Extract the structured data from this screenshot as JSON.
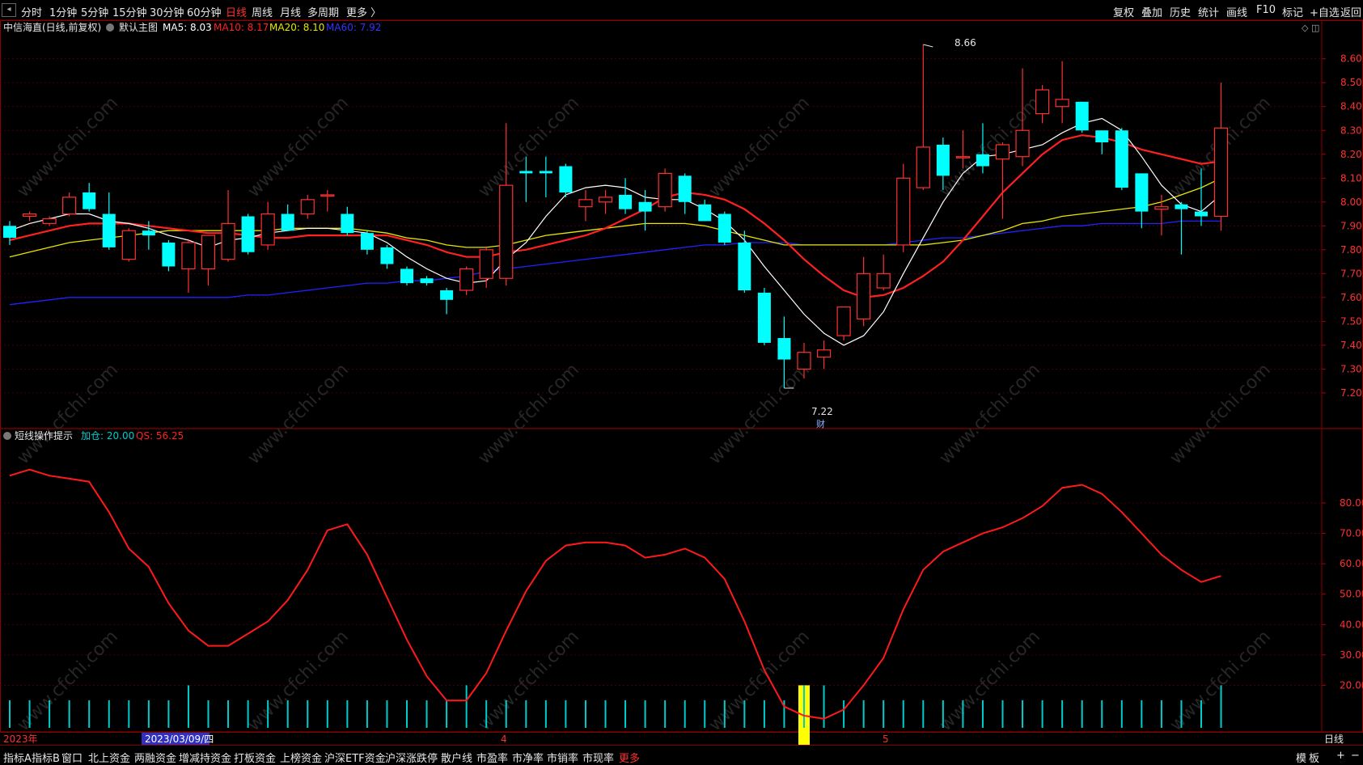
{
  "top_tabs": [
    "分时",
    "1分钟",
    "5分钟",
    "15分钟",
    "30分钟",
    "60分钟",
    "日线",
    "周线",
    "月线",
    "多周期",
    "更多 〉"
  ],
  "active_tab": "日线",
  "right_tools": [
    "复权",
    "叠加",
    "历史",
    "统计",
    "画线",
    "F10",
    "标记",
    "+自选",
    "返回"
  ],
  "main_legend": {
    "stock": "中信海直(日线,前复权)",
    "template": "默认主图",
    "ma5": "MA5: 8.03",
    "ma10": "MA10: 8.17",
    "ma20": "MA20: 8.10",
    "ma60": "MA60: 7.92"
  },
  "sub_legend": {
    "name": "短线操作提示",
    "jiacang": "加仓: 20.00",
    "qs": "QS: 56.25"
  },
  "annotations": {
    "high": "8.66",
    "low": "7.22",
    "cai": "财"
  },
  "watermark": "www.cfchi.com",
  "date_axis": {
    "year": "2023年",
    "cursor_date": "2023/03/09/四",
    "m4": "4",
    "m5": "5",
    "period": "日线"
  },
  "bottom_tabs": [
    "指标A",
    "指标B",
    "窗口",
    "北上资金",
    "两融资金",
    "增减持资金",
    "打板资金",
    "上榜资金",
    "沪深ETF资金",
    "沪深涨跌停",
    "散户线",
    "市盈率",
    "市净率",
    "市销率",
    "市现率",
    "更多"
  ],
  "bottom_right": [
    "模",
    "板",
    "+",
    "−"
  ],
  "colors": {
    "up": "#ff3030",
    "down": "#00ffff",
    "ma5": "#ffffff",
    "ma10": "#ff2020",
    "ma20": "#e6e600",
    "ma60": "#2222ff",
    "qs": "#ff1a1a",
    "signal": "#ffff00",
    "frame": "#8b0000"
  },
  "chart_data": {
    "type": "candlestick",
    "price_axis": {
      "ylim": [
        7.15,
        8.7
      ],
      "ticks": [
        "8.60",
        "8.50",
        "8.40",
        "8.30",
        "8.20",
        "8.10",
        "8.00",
        "7.90",
        "7.80",
        "7.70",
        "7.60",
        "7.50",
        "7.40",
        "7.30",
        "7.20"
      ]
    },
    "candles": [
      {
        "o": 7.9,
        "h": 7.92,
        "l": 7.82,
        "c": 7.85
      },
      {
        "o": 7.94,
        "h": 7.96,
        "l": 7.92,
        "c": 7.95
      },
      {
        "o": 7.91,
        "h": 7.94,
        "l": 7.9,
        "c": 7.93
      },
      {
        "o": 7.95,
        "h": 8.04,
        "l": 7.94,
        "c": 8.02
      },
      {
        "o": 8.04,
        "h": 8.08,
        "l": 7.96,
        "c": 7.97
      },
      {
        "o": 7.95,
        "h": 8.04,
        "l": 7.8,
        "c": 7.81
      },
      {
        "o": 7.76,
        "h": 7.89,
        "l": 7.75,
        "c": 7.88
      },
      {
        "o": 7.88,
        "h": 7.92,
        "l": 7.8,
        "c": 7.86
      },
      {
        "o": 7.83,
        "h": 7.84,
        "l": 7.71,
        "c": 7.73
      },
      {
        "o": 7.72,
        "h": 7.84,
        "l": 7.62,
        "c": 7.83
      },
      {
        "o": 7.72,
        "h": 7.86,
        "l": 7.65,
        "c": 7.86
      },
      {
        "o": 7.76,
        "h": 8.05,
        "l": 7.75,
        "c": 7.91
      },
      {
        "o": 7.94,
        "h": 7.95,
        "l": 7.78,
        "c": 7.79
      },
      {
        "o": 7.82,
        "h": 8.0,
        "l": 7.8,
        "c": 7.95
      },
      {
        "o": 7.95,
        "h": 7.99,
        "l": 7.88,
        "c": 7.88
      },
      {
        "o": 7.95,
        "h": 8.03,
        "l": 7.93,
        "c": 8.01
      },
      {
        "o": 8.03,
        "h": 8.05,
        "l": 7.96,
        "c": 8.03
      },
      {
        "o": 7.95,
        "h": 7.98,
        "l": 7.86,
        "c": 7.87
      },
      {
        "o": 7.87,
        "h": 7.88,
        "l": 7.78,
        "c": 7.8
      },
      {
        "o": 7.81,
        "h": 7.82,
        "l": 7.72,
        "c": 7.74
      },
      {
        "o": 7.72,
        "h": 7.73,
        "l": 7.65,
        "c": 7.66
      },
      {
        "o": 7.68,
        "h": 7.69,
        "l": 7.65,
        "c": 7.66
      },
      {
        "o": 7.63,
        "h": 7.64,
        "l": 7.53,
        "c": 7.59
      },
      {
        "o": 7.63,
        "h": 7.73,
        "l": 7.61,
        "c": 7.72
      },
      {
        "o": 7.68,
        "h": 7.81,
        "l": 7.64,
        "c": 7.8
      },
      {
        "o": 7.68,
        "h": 8.33,
        "l": 7.65,
        "c": 8.07
      },
      {
        "o": 8.13,
        "h": 8.19,
        "l": 8.0,
        "c": 8.12
      },
      {
        "o": 8.13,
        "h": 8.19,
        "l": 8.02,
        "c": 8.12
      },
      {
        "o": 8.15,
        "h": 8.16,
        "l": 8.02,
        "c": 8.04
      },
      {
        "o": 7.98,
        "h": 8.05,
        "l": 7.92,
        "c": 8.01
      },
      {
        "o": 8.0,
        "h": 8.05,
        "l": 7.95,
        "c": 8.02
      },
      {
        "o": 8.03,
        "h": 8.1,
        "l": 7.95,
        "c": 7.97
      },
      {
        "o": 8.0,
        "h": 8.05,
        "l": 7.88,
        "c": 7.96
      },
      {
        "o": 7.98,
        "h": 8.14,
        "l": 7.96,
        "c": 8.12
      },
      {
        "o": 8.11,
        "h": 8.12,
        "l": 7.95,
        "c": 8.0
      },
      {
        "o": 7.99,
        "h": 8.01,
        "l": 7.92,
        "c": 7.92
      },
      {
        "o": 7.95,
        "h": 7.96,
        "l": 7.82,
        "c": 7.83
      },
      {
        "o": 7.83,
        "h": 7.88,
        "l": 7.62,
        "c": 7.63
      },
      {
        "o": 7.62,
        "h": 7.64,
        "l": 7.4,
        "c": 7.41
      },
      {
        "o": 7.43,
        "h": 7.52,
        "l": 7.22,
        "c": 7.34
      },
      {
        "o": 7.3,
        "h": 7.41,
        "l": 7.26,
        "c": 7.37
      },
      {
        "o": 7.35,
        "h": 7.42,
        "l": 7.3,
        "c": 7.38
      },
      {
        "o": 7.44,
        "h": 7.56,
        "l": 7.42,
        "c": 7.56
      },
      {
        "o": 7.51,
        "h": 7.77,
        "l": 7.48,
        "c": 7.7
      },
      {
        "o": 7.64,
        "h": 7.78,
        "l": 7.63,
        "c": 7.7
      },
      {
        "o": 7.82,
        "h": 8.16,
        "l": 7.79,
        "c": 8.1
      },
      {
        "o": 8.06,
        "h": 8.66,
        "l": 8.05,
        "c": 8.23
      },
      {
        "o": 8.24,
        "h": 8.27,
        "l": 8.05,
        "c": 8.11
      },
      {
        "o": 8.19,
        "h": 8.3,
        "l": 8.14,
        "c": 8.19
      },
      {
        "o": 8.2,
        "h": 8.33,
        "l": 8.12,
        "c": 8.15
      },
      {
        "o": 8.18,
        "h": 8.25,
        "l": 7.93,
        "c": 8.24
      },
      {
        "o": 8.19,
        "h": 8.56,
        "l": 8.15,
        "c": 8.3
      },
      {
        "o": 8.37,
        "h": 8.49,
        "l": 8.33,
        "c": 8.47
      },
      {
        "o": 8.4,
        "h": 8.59,
        "l": 8.33,
        "c": 8.43
      },
      {
        "o": 8.42,
        "h": 8.42,
        "l": 8.29,
        "c": 8.3
      },
      {
        "o": 8.3,
        "h": 8.3,
        "l": 8.2,
        "c": 8.25
      },
      {
        "o": 8.3,
        "h": 8.31,
        "l": 8.05,
        "c": 8.06
      },
      {
        "o": 8.12,
        "h": 8.12,
        "l": 7.89,
        "c": 7.96
      },
      {
        "o": 7.97,
        "h": 8.03,
        "l": 7.86,
        "c": 7.98
      },
      {
        "o": 7.99,
        "h": 8.0,
        "l": 7.78,
        "c": 7.97
      },
      {
        "o": 7.96,
        "h": 8.14,
        "l": 7.9,
        "c": 7.94
      },
      {
        "o": 7.94,
        "h": 8.5,
        "l": 7.88,
        "c": 8.31
      }
    ],
    "ma5": [
      7.88,
      7.91,
      7.93,
      7.95,
      7.95,
      7.92,
      7.91,
      7.89,
      7.86,
      7.84,
      7.81,
      7.84,
      7.85,
      7.87,
      7.88,
      7.89,
      7.89,
      7.88,
      7.87,
      7.83,
      7.77,
      7.72,
      7.68,
      7.66,
      7.67,
      7.76,
      7.83,
      7.94,
      8.03,
      8.06,
      8.07,
      8.06,
      8.02,
      8.01,
      8.01,
      7.97,
      7.92,
      7.84,
      7.73,
      7.63,
      7.53,
      7.45,
      7.4,
      7.44,
      7.54,
      7.7,
      7.85,
      8.0,
      8.12,
      8.19,
      8.2,
      8.22,
      8.24,
      8.29,
      8.33,
      8.35,
      8.3,
      8.19,
      8.07,
      7.99,
      7.96,
      8.03
    ],
    "ma10": [
      7.84,
      7.86,
      7.88,
      7.9,
      7.91,
      7.91,
      7.91,
      7.9,
      7.89,
      7.88,
      7.87,
      7.87,
      7.86,
      7.85,
      7.85,
      7.86,
      7.86,
      7.86,
      7.86,
      7.86,
      7.84,
      7.82,
      7.79,
      7.77,
      7.77,
      7.79,
      7.8,
      7.82,
      7.84,
      7.86,
      7.89,
      7.93,
      7.97,
      8.02,
      8.04,
      8.03,
      8.01,
      7.97,
      7.91,
      7.84,
      7.76,
      7.69,
      7.63,
      7.6,
      7.61,
      7.64,
      7.69,
      7.75,
      7.84,
      7.94,
      8.04,
      8.12,
      8.2,
      8.26,
      8.28,
      8.27,
      8.25,
      8.22,
      8.2,
      8.18,
      8.16,
      8.17
    ],
    "ma20": [
      7.77,
      7.79,
      7.81,
      7.83,
      7.84,
      7.85,
      7.86,
      7.87,
      7.88,
      7.88,
      7.88,
      7.88,
      7.88,
      7.88,
      7.89,
      7.89,
      7.89,
      7.89,
      7.88,
      7.87,
      7.85,
      7.84,
      7.82,
      7.81,
      7.81,
      7.82,
      7.84,
      7.86,
      7.87,
      7.88,
      7.89,
      7.9,
      7.91,
      7.91,
      7.91,
      7.9,
      7.88,
      7.86,
      7.84,
      7.82,
      7.82,
      7.82,
      7.82,
      7.82,
      7.82,
      7.82,
      7.82,
      7.83,
      7.84,
      7.86,
      7.88,
      7.91,
      7.92,
      7.94,
      7.95,
      7.96,
      7.97,
      7.98,
      8.0,
      8.03,
      8.06,
      8.1
    ],
    "ma60": [
      7.57,
      7.58,
      7.59,
      7.6,
      7.6,
      7.6,
      7.6,
      7.6,
      7.6,
      7.6,
      7.6,
      7.6,
      7.61,
      7.61,
      7.62,
      7.63,
      7.64,
      7.65,
      7.66,
      7.66,
      7.67,
      7.67,
      7.68,
      7.69,
      7.71,
      7.72,
      7.73,
      7.74,
      7.75,
      7.76,
      7.77,
      7.78,
      7.79,
      7.8,
      7.81,
      7.82,
      7.82,
      7.83,
      7.83,
      7.83,
      7.82,
      7.82,
      7.82,
      7.82,
      7.82,
      7.83,
      7.84,
      7.85,
      7.85,
      7.86,
      7.87,
      7.88,
      7.89,
      7.9,
      7.9,
      7.91,
      7.91,
      7.91,
      7.91,
      7.92,
      7.92,
      7.92
    ],
    "indicator": {
      "name": "短线操作提示",
      "ylim": [
        0,
        100
      ],
      "ticks": [
        "80.00",
        "70.00",
        "60.00",
        "50.00",
        "40.00",
        "30.00",
        "20.00"
      ],
      "qs": [
        89,
        91,
        89,
        88,
        87,
        77,
        65,
        59,
        47,
        38,
        33,
        33,
        37,
        41,
        48,
        58,
        71,
        73,
        63,
        49,
        35,
        23,
        15,
        15,
        24,
        38,
        51,
        61,
        66,
        67,
        67,
        66,
        62,
        63,
        65,
        62,
        55,
        41,
        25,
        13,
        10,
        9,
        12,
        20,
        29,
        45,
        58,
        64,
        67,
        70,
        72,
        75,
        79,
        85,
        86,
        83,
        77,
        70,
        63,
        58,
        54,
        56
      ],
      "tall_bars": [
        9,
        23,
        40,
        41,
        61
      ],
      "signal_index": 40
    }
  }
}
